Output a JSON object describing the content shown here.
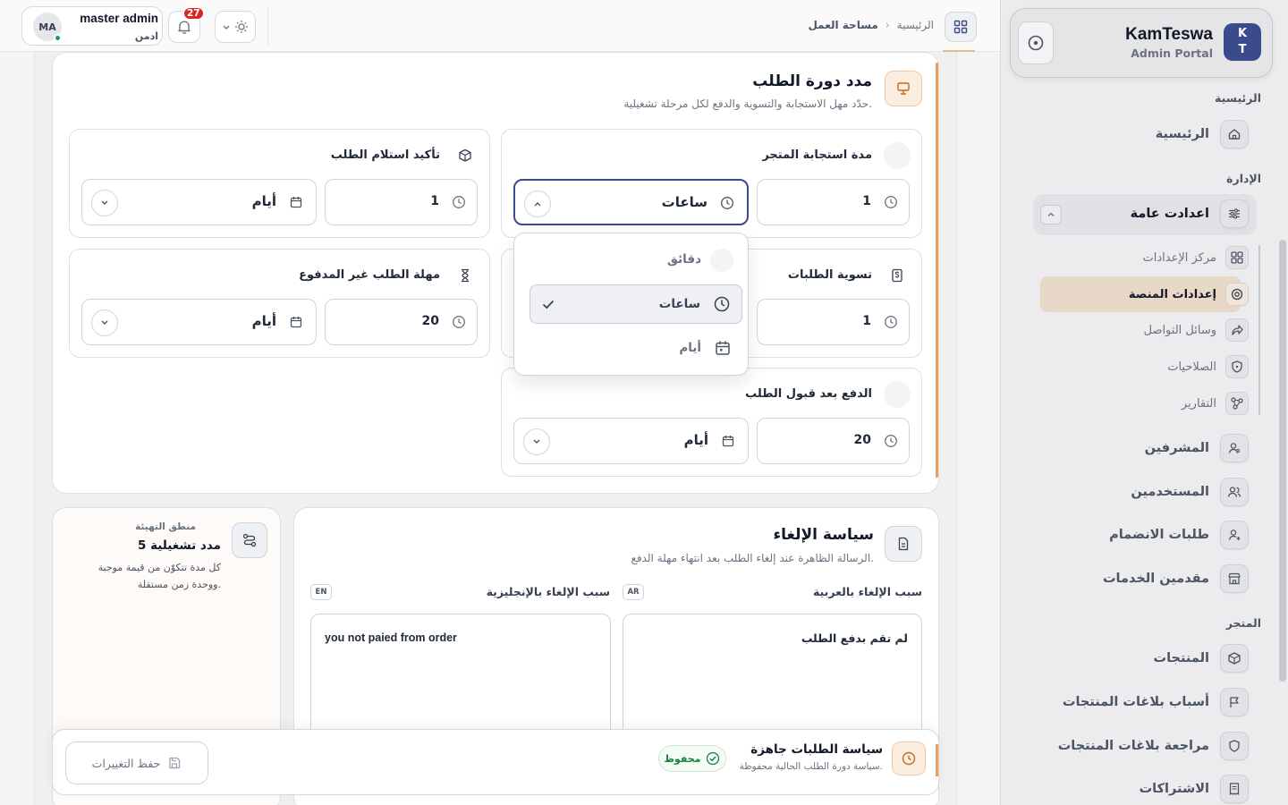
{
  "brand": {
    "logo_line1": "K",
    "logo_line2": "T",
    "name": "KamTeswa",
    "subtitle": "Admin Portal"
  },
  "header": {
    "breadcrumb_home": "الرئيسية",
    "breadcrumb_separator": "›",
    "breadcrumb_current": "مساحة العمل",
    "user_initials": "MA",
    "user_name": "master admin",
    "user_role": "ادمن",
    "notification_count": "27"
  },
  "sidebar": {
    "section_home": "الرئيسية",
    "home_item": "الرئيسية",
    "section_admin": "الإدارة",
    "general_settings": "اعدادت عامة",
    "sub_items": [
      {
        "label": "مركز الإعدادات",
        "icon": "grid-icon"
      },
      {
        "label": "إعدادات المنصة",
        "icon": "settings-icon"
      },
      {
        "label": "وسائل التواصل",
        "icon": "share-icon"
      },
      {
        "label": "الصلاحيات",
        "icon": "shield-icon"
      },
      {
        "label": "التقارير",
        "icon": "graph-icon"
      }
    ],
    "admin_items": [
      {
        "label": "المشرفين",
        "icon": "user-icon"
      },
      {
        "label": "المستخدمين",
        "icon": "users-icon"
      },
      {
        "label": "طلبات الانضمام",
        "icon": "user-add-icon"
      },
      {
        "label": "مقدمين الخدمات",
        "icon": "store-icon"
      }
    ],
    "section_store": "المتجر",
    "store_items": [
      {
        "label": "المنتجات",
        "icon": "box-icon"
      },
      {
        "label": "أسباب بلاغات المنتجات",
        "icon": "flag-icon"
      },
      {
        "label": "مراجعة بلاغات المنتجات",
        "icon": "shield-icon"
      },
      {
        "label": "الاشتراكات",
        "icon": "receipt-icon"
      }
    ]
  },
  "main": {
    "title": "مدد دورة الطلب",
    "subtitle": "حدّد مهل الاستجابة والتسوية والدفع لكل مرحلة تشغيلية.",
    "cards": {
      "store_response": {
        "title": "مدة استجابة المتجر",
        "value": "1",
        "unit": "ساعات"
      },
      "order_confirm": {
        "title": "تأكيد استلام الطلب",
        "value": "1",
        "unit": "أيام"
      },
      "settlement": {
        "title": "تسوية الطلبات",
        "value": "1"
      },
      "unpaid": {
        "title": "مهلة الطلب غير المدفوع",
        "value": "20",
        "unit": "أيام"
      },
      "payment_after": {
        "title": "الدفع بعد قبول الطلب",
        "value": "20",
        "unit": "أيام"
      }
    },
    "dropdown": {
      "options": [
        "دقائق",
        "ساعات",
        "أيام"
      ],
      "selected": "ساعات"
    }
  },
  "cancel_policy": {
    "title": "سياسة الإلغاء",
    "subtitle": "الرسالة الظاهرة عند إلغاء الطلب بعد انتهاء مهلة الدفع.",
    "ar_label": "سبب الإلغاء بالعربية",
    "ar_tag": "AR",
    "ar_value": "لم تقم بدفع الطلب",
    "en_label": "سبب الإلغاء بالإنجليزية",
    "en_tag": "EN",
    "en_value": "you not paied from order"
  },
  "logic_card": {
    "caption": "منطق التهيئة",
    "title": "5 مدد تشغيلية",
    "desc_line1": "كل مدة تتكوّن من قيمة موجبة",
    "desc_line2": "ووحدة زمن مستقلة."
  },
  "save_bar": {
    "title": "سياسة الطلبات جاهزة",
    "subtitle": "سياسة دورة الطلب الحالية محفوظة.",
    "status": "محفوظ",
    "save_label": "حفظ التغييرات"
  },
  "colors": {
    "accent": "#e6a15b",
    "brand": "#3b4a8c",
    "active_item": "#e8d8c8",
    "badge": "#dc2626",
    "success": "#15803d"
  }
}
